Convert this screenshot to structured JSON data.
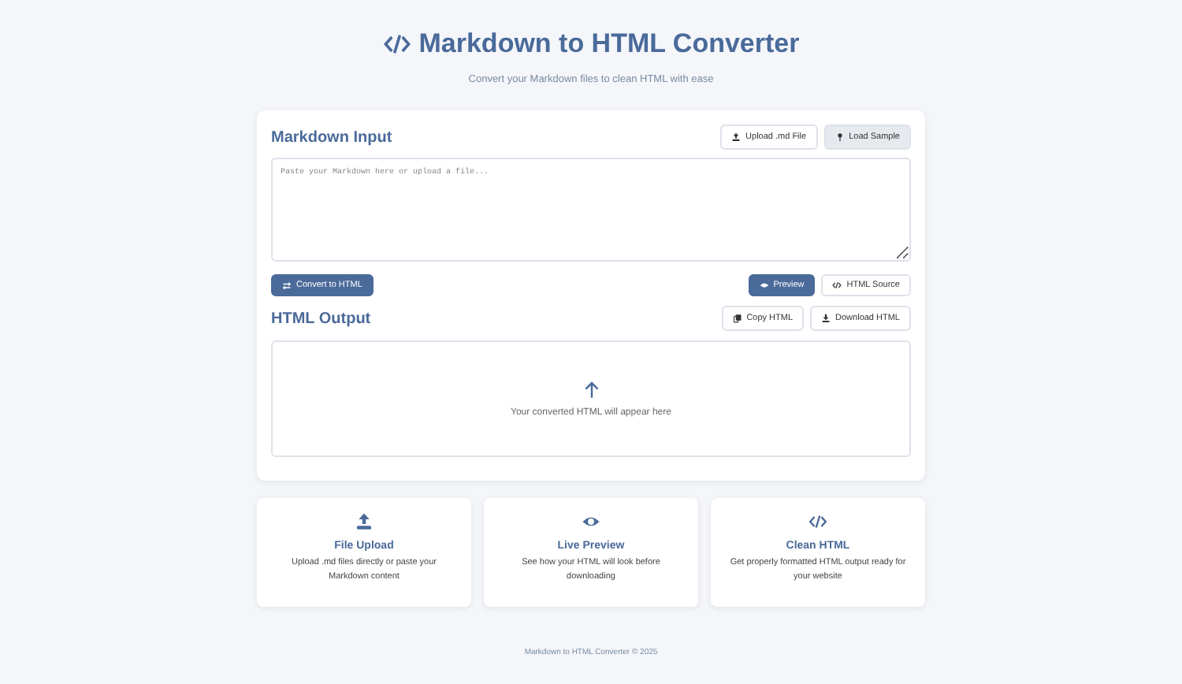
{
  "header": {
    "title": "Markdown to HTML Converter",
    "subtitle": "Convert your Markdown files to clean HTML with ease"
  },
  "input": {
    "heading": "Markdown Input",
    "buttons": [
      "Upload .md File",
      "Load Sample"
    ],
    "placeholder": "Paste your Markdown here or upload a file..."
  },
  "convert_button": {
    "label": "Convert to HTML"
  },
  "view_tabs": [
    {
      "label": "Preview",
      "selected": true
    },
    {
      "label": "HTML Source",
      "selected": false
    }
  ],
  "output": {
    "heading": "HTML Output",
    "buttons": [
      "Copy HTML",
      "Download HTML"
    ],
    "empty_message": "Your converted HTML will appear here"
  },
  "features": [
    {
      "title": "File Upload",
      "text": "Upload .md files directly or paste your Markdown content"
    },
    {
      "title": "Live Preview",
      "text": "See how your HTML will look before downloading"
    },
    {
      "title": "Clean HTML",
      "text": "Get properly formatted HTML output ready for your website"
    }
  ],
  "footer": "Markdown to HTML Converter © 2025"
}
